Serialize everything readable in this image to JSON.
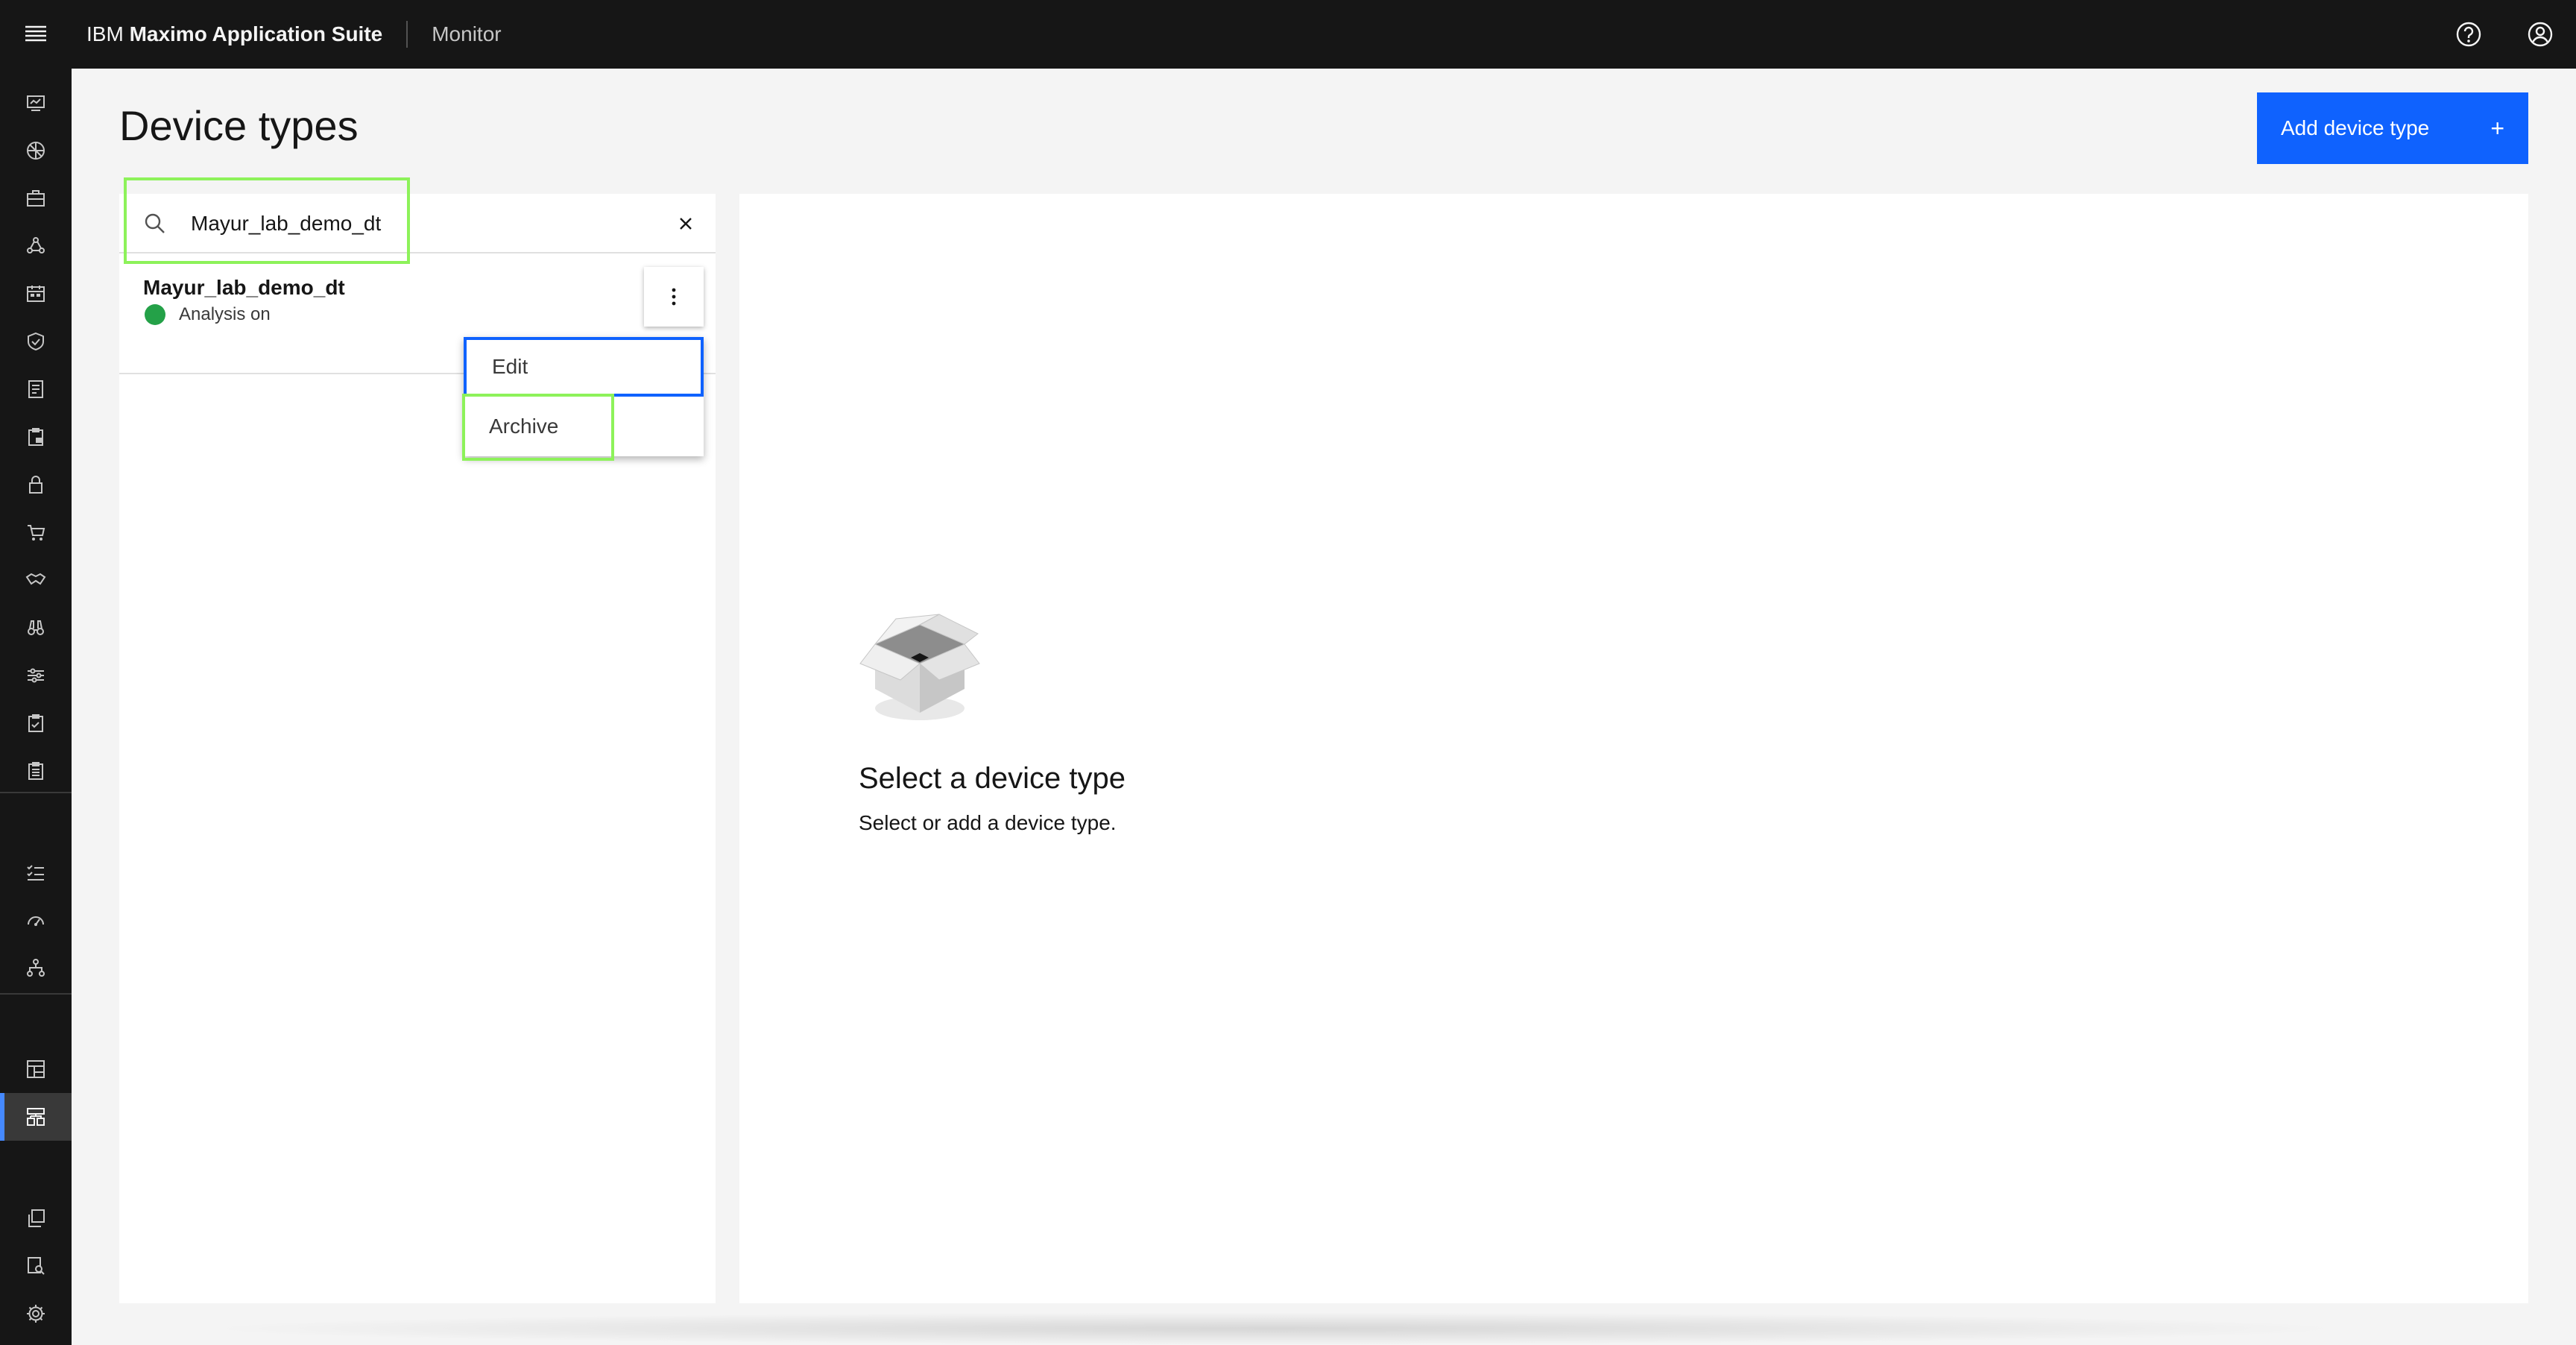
{
  "header": {
    "brand_prefix": "IBM",
    "brand_name": "Maximo Application Suite",
    "app_name": "Monitor"
  },
  "page": {
    "title": "Device types",
    "add_button_label": "Add device type",
    "add_button_icon": "+"
  },
  "search": {
    "value": "Mayur_lab_demo_dt",
    "clear_icon": "close-icon"
  },
  "device_list": [
    {
      "name": "Mayur_lab_demo_dt",
      "status": "Analysis on",
      "status_color": "#24a148"
    }
  ],
  "overflow_menu": {
    "items": [
      "Edit",
      "Archive"
    ],
    "focused_item": "Edit"
  },
  "empty_state": {
    "title": "Select a device type",
    "subtitle": "Select or add a device type."
  },
  "rail_icons": [
    "monitor-icon",
    "dashboard-icon",
    "assets-icon",
    "network-icon",
    "calendar-icon",
    "shield-icon",
    "document-icon",
    "clipboard-lock-icon",
    "lock-icon",
    "cart-icon",
    "handshake-icon",
    "binoculars-icon",
    "sliders-icon",
    "checklist-clipboard-icon",
    "list-clipboard-icon",
    "task-list-icon",
    "gauge-icon",
    "hierarchy-icon",
    "table-chart-icon",
    "data-structure-icon",
    "copy-icon",
    "device-search-icon",
    "settings-icon"
  ],
  "colors": {
    "accent": "#0f62fe",
    "header_bg": "#161616",
    "highlight": "#8df25a",
    "status_green": "#24a148"
  }
}
